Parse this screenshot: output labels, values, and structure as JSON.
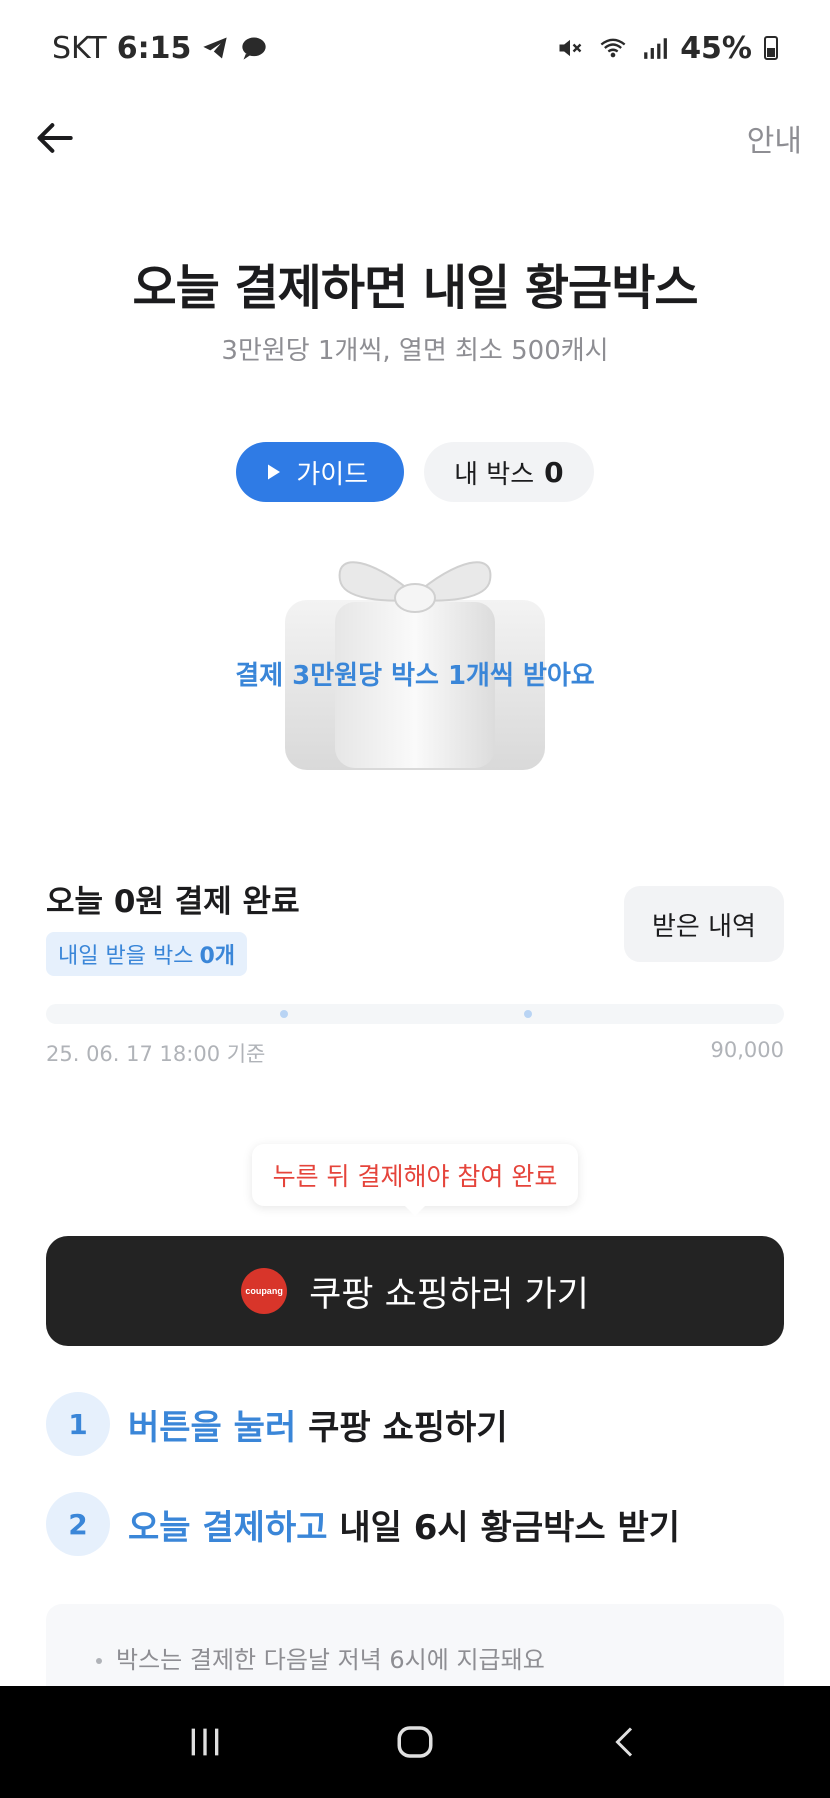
{
  "status_bar": {
    "carrier": "SKT",
    "time": "6:15",
    "battery": "45%"
  },
  "header": {
    "info_label": "안내"
  },
  "hero": {
    "title": "오늘 결제하면 내일 황금박스",
    "subtitle": "3만원당 1개씩, 열면 최소 500캐시"
  },
  "pills": {
    "guide_label": "가이드",
    "box_label": "내 박스",
    "box_count": "0"
  },
  "gift": {
    "caption": "결제 3만원당 박스 1개씩 받아요"
  },
  "summary": {
    "today_text": "오늘 0원 결제 완료",
    "tomorrow_label": "내일 받을 박스",
    "tomorrow_count": "0개",
    "history_button": "받은 내역"
  },
  "progress": {
    "value_fraction": 0.0,
    "start_label": "25. 06. 17 18:00 기준",
    "end_label": "90,000"
  },
  "tooltip": {
    "text": "누른 뒤 결제해야 참여 완료"
  },
  "cta": {
    "label": "쿠팡 쇼핑하러 가기",
    "logo_text": "coupang"
  },
  "steps": [
    {
      "num": "1",
      "highlight": "버튼을 눌러",
      "rest": "쿠팡 쇼핑하기"
    },
    {
      "num": "2",
      "highlight": "오늘 결제하고",
      "rest": "내일 6시 황금박스 받기"
    }
  ],
  "notice": {
    "items": [
      "박스는 결제한 다음날 저녁 6시에 지급돼요"
    ]
  },
  "icons": {
    "back": "arrow-left-icon",
    "play": "play-icon",
    "gift": "gift-box-icon",
    "nav_recent": "recent-apps-icon",
    "nav_home": "home-icon",
    "nav_back": "chevron-left-icon"
  },
  "colors": {
    "accent": "#2f7be5",
    "text_blue": "#3a86d8",
    "warning": "#e5443b",
    "cta_bg": "#232323"
  }
}
